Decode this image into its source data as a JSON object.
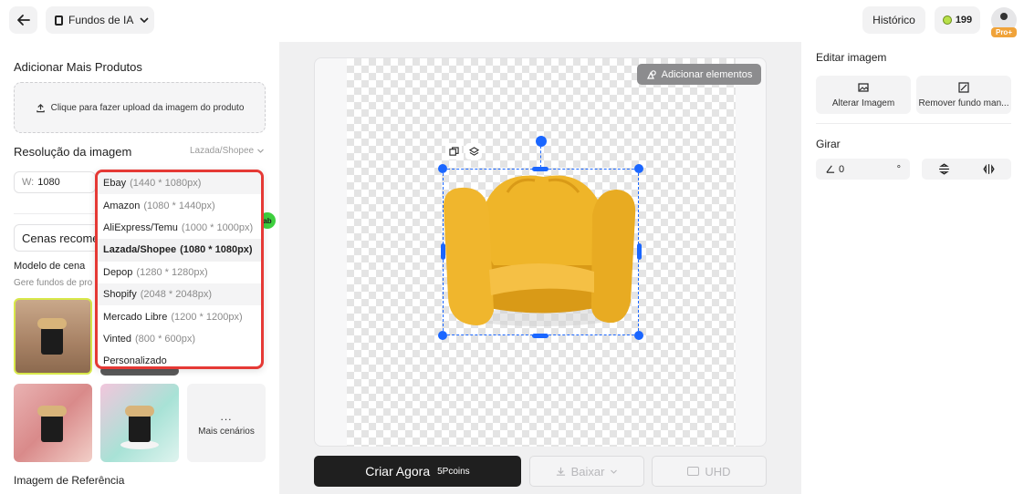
{
  "topbar": {
    "title": "Fundos de IA",
    "history_label": "Histórico",
    "coins": "199",
    "plan_badge": "Pro+"
  },
  "left": {
    "add_products_title": "Adicionar Mais Produtos",
    "upload_label": "Clique para fazer upload da imagem do produto",
    "resolution_title": "Resolução da imagem",
    "resolution_selected": "Lazada/Shopee",
    "width_label": "W:",
    "width_value": "1080",
    "scenes_label": "Cenas recome",
    "scene_model_title": "Modelo de cena",
    "scene_model_sub": "Gere fundos de pro",
    "more_scenes": "Mais cenários",
    "more_dots": "...",
    "reference_title": "Imagem de Referência",
    "badge_text": "ab"
  },
  "dropdown": {
    "items": [
      {
        "name": "Ebay",
        "res": "(1440 * 1080px)"
      },
      {
        "name": "Amazon",
        "res": "(1080 * 1440px)"
      },
      {
        "name": "AliExpress/Temu",
        "res": "(1000 * 1000px)"
      },
      {
        "name": "Lazada/Shopee",
        "res": "(1080 * 1080px)"
      },
      {
        "name": "Depop",
        "res": "(1280 * 1280px)"
      },
      {
        "name": "Shopify",
        "res": "(2048 * 2048px)"
      },
      {
        "name": "Mercado Libre",
        "res": "(1200 * 1200px)"
      },
      {
        "name": "Vinted",
        "res": "(800 * 600px)"
      },
      {
        "name": "Personalizado",
        "res": ""
      }
    ],
    "selected_index": 3
  },
  "canvas": {
    "add_elements_label": "Adicionar elementos",
    "create_label": "Criar Agora",
    "create_cost": "5Pcoins",
    "download_label": "Baixar",
    "uhd_label": "UHD"
  },
  "right": {
    "edit_title": "Editar imagem",
    "alter_image": "Alterar Imagem",
    "remove_bg": "Remover fundo man...",
    "rotate_title": "Girar",
    "rotate_value": "0",
    "degree_symbol": "°"
  },
  "colors": {
    "accent": "#1a66ff",
    "dropdown_border": "#e53935",
    "primary_button": "#1f1f1f",
    "badge_green": "#3ecf3e",
    "chair": "#e8a91c"
  }
}
